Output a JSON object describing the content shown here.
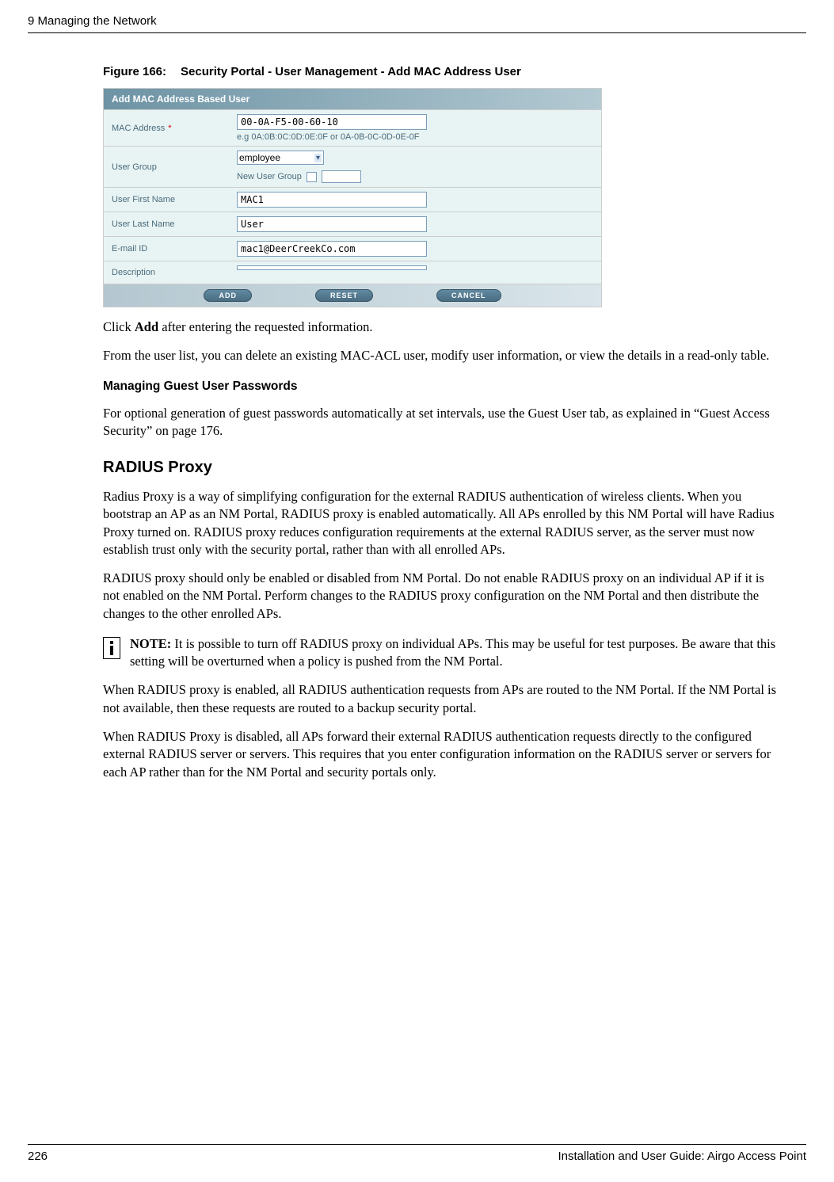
{
  "header": {
    "chapter": "9  Managing the Network"
  },
  "figure": {
    "number": "Figure 166:",
    "title": "Security Portal - User Management - Add MAC Address User"
  },
  "screenshot": {
    "panel_title": "Add MAC Address Based User",
    "rows": {
      "mac_address": {
        "label": "MAC Address",
        "required": "*",
        "value": "00-0A-F5-00-60-10",
        "hint": "e.g 0A:0B:0C:0D:0E:0F or 0A-0B-0C-0D-0E-0F"
      },
      "user_group": {
        "label": "User Group",
        "selected": "employee",
        "new_group_label": "New User Group"
      },
      "first_name": {
        "label": "User First Name",
        "value": "MAC1"
      },
      "last_name": {
        "label": "User Last Name",
        "value": "User"
      },
      "email": {
        "label": "E-mail ID",
        "value": "mac1@DeerCreekCo.com"
      },
      "description": {
        "label": "Description",
        "value": ""
      }
    },
    "buttons": {
      "add": "ADD",
      "reset": "RESET",
      "cancel": "CANCEL"
    }
  },
  "body": {
    "p1": "Click Add after entering the requested information.",
    "p1_prefix": "Click ",
    "p1_bold": "Add",
    "p1_suffix": " after entering the requested information.",
    "p2": "From the user list, you can delete an existing MAC-ACL user, modify user information, or view the details in a read-only table.",
    "sub1": "Managing Guest User Passwords",
    "p3": "For optional generation of guest passwords automatically at set intervals, use the Guest User tab, as explained in “Guest Access Security” on page 176.",
    "h2": "RADIUS Proxy",
    "p4": "Radius Proxy is a way of simplifying configuration for the external RADIUS authentication of wireless clients. When you bootstrap an AP as an NM Portal, RADIUS proxy is enabled automatically. All APs enrolled by this NM Portal will have Radius Proxy turned on. RADIUS proxy reduces configuration requirements at the external RADIUS server, as the server must now establish trust only with the security portal, rather than with all enrolled APs.",
    "p5": "RADIUS proxy should only be enabled or disabled from NM Portal. Do not enable RADIUS proxy on an individual AP if it is not enabled on the NM Portal. Perform changes to the RADIUS proxy configuration on the NM Portal and then distribute the changes to the other enrolled APs.",
    "note_label": "NOTE:",
    "note_text": " It is possible to turn off RADIUS proxy on individual APs. This may be useful for test purposes. Be aware that this setting will be overturned when a policy is pushed from the NM Portal.",
    "p6": "When RADIUS proxy is enabled, all RADIUS authentication requests from APs are routed to the NM Portal.   If the NM Portal is not available, then these requests are routed to a backup security portal.",
    "p7": "When RADIUS Proxy is disabled, all APs forward their external RADIUS authentication requests directly to the configured external RADIUS server or servers. This requires that you enter configuration information on the RADIUS server or servers for each AP rather than for the NM Portal and security portals only."
  },
  "footer": {
    "page": "226",
    "doc": "Installation and User Guide: Airgo Access Point"
  }
}
